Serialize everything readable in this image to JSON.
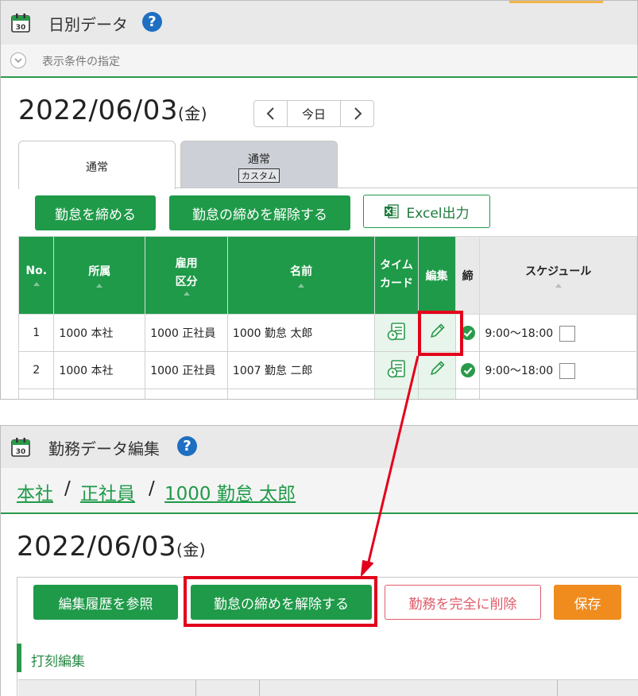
{
  "top": {
    "title": "日別データ",
    "help": "?",
    "conditions_label": "表示条件の指定",
    "date": "2022/06/03",
    "weekday": "(金)",
    "nav": {
      "prev": "‹",
      "today": "今日",
      "next": "›"
    },
    "tabs": [
      {
        "label": "通常"
      },
      {
        "label": "通常",
        "sub": "カスタム"
      }
    ],
    "buttons": {
      "close": "勤怠を締める",
      "unclose": "勤怠の締めを解除する",
      "excel": "Excel出力"
    },
    "table": {
      "headers": {
        "no": "No.",
        "dept": "所属",
        "emp_type_1": "雇用",
        "emp_type_2": "区分",
        "name": "名前",
        "timecard_1": "タイム",
        "timecard_2": "カード",
        "edit": "編集",
        "closed": "締",
        "schedule": "スケジュール"
      },
      "rows": [
        {
          "no": "1",
          "dept": "1000 本社",
          "type": "1000 正社員",
          "name": "1000 勤怠 太郎",
          "schedule": "9:00～18:00"
        },
        {
          "no": "2",
          "dept": "1000 本社",
          "type": "1000 正社員",
          "name": "1007 勤怠 二郎",
          "schedule": "9:00～18:00"
        }
      ]
    }
  },
  "bottom": {
    "title": "勤務データ編集",
    "help": "?",
    "breadcrumb": {
      "dept": "本社",
      "sep": "/",
      "type": "正社員",
      "person": "1000 勤怠 太郎"
    },
    "date": "2022/06/03",
    "weekday": "(金)",
    "buttons": {
      "history": "編集履歴を参照",
      "unclose": "勤怠の締めを解除する",
      "delete": "勤務を完全に削除",
      "save": "保存"
    },
    "section_title": "打刻編集"
  },
  "colors": {
    "accent_green": "#1f9a49",
    "highlight_red": "#e3001b",
    "danger": "#e05b6a",
    "save_orange": "#f08b1e",
    "help_blue": "#1e6fc2"
  },
  "icons": [
    "calendar-icon",
    "help-icon",
    "chevron-down-icon",
    "chevron-left-icon",
    "chevron-right-icon",
    "excel-icon",
    "timecard-icon",
    "pencil-icon",
    "check-circle-icon"
  ]
}
